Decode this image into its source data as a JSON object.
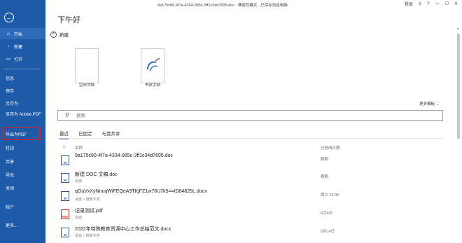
{
  "titlebar": {
    "title": "9a175c80-4f7a-4334-985c-3ff1c34d7695.doc  ·  兼容性模式  ·  已保存到此电脑",
    "signin": "登录"
  },
  "sidebar": {
    "back_icon": "back-arrow-icon",
    "items": [
      {
        "label": "开始",
        "icon": "home-icon"
      },
      {
        "label": "新建",
        "icon": "new-doc-icon"
      },
      {
        "label": "打开",
        "icon": "folder-icon"
      },
      {
        "label": "信息"
      },
      {
        "label": "保存"
      },
      {
        "label": "另存为"
      },
      {
        "label": "另存为 Adobe PDF"
      },
      {
        "label": "导出为PDF"
      },
      {
        "label": "打印"
      },
      {
        "label": "共享"
      },
      {
        "label": "导出"
      },
      {
        "label": "关闭"
      },
      {
        "label": "帐户"
      },
      {
        "label": "更多..."
      }
    ],
    "accent_color": "#1e5aa8"
  },
  "main": {
    "greeting": "下午好",
    "new_section": "新建",
    "templates": [
      {
        "label": "空白文档"
      },
      {
        "label": "书法字帖"
      }
    ],
    "more_templates": "更多模板 →",
    "search": {
      "placeholder": "搜索"
    },
    "tabs": [
      "最近",
      "已固定",
      "与我共享"
    ],
    "columns": {
      "name": "名称",
      "date": "已修改日期"
    },
    "files": [
      {
        "name": "9a175c80-4f7a-4334-985c-3ff1c34d7695.doc",
        "path": "",
        "date": "刚刚",
        "type": "W"
      },
      {
        "name": "新建 DOC 文稿.doc",
        "path": "桌面",
        "date": "刚刚",
        "type": "W"
      },
      {
        "name": "qGuVxXyNnuqWiFEQeA9TKjFZ1w76U7k5==ID84825L.docx",
        "path": "桌面 » 摄像专用",
        "date": "周二 22:45",
        "type": "W"
      },
      {
        "name": "记录测试.pdf",
        "path": "桌面",
        "date": "6月6日",
        "type": "PDF"
      },
      {
        "name": "2022年特殊教育资源中心工作总结范文.docx",
        "path": "桌面 » 摄像专用",
        "date": "5月14日",
        "type": "W"
      }
    ]
  }
}
